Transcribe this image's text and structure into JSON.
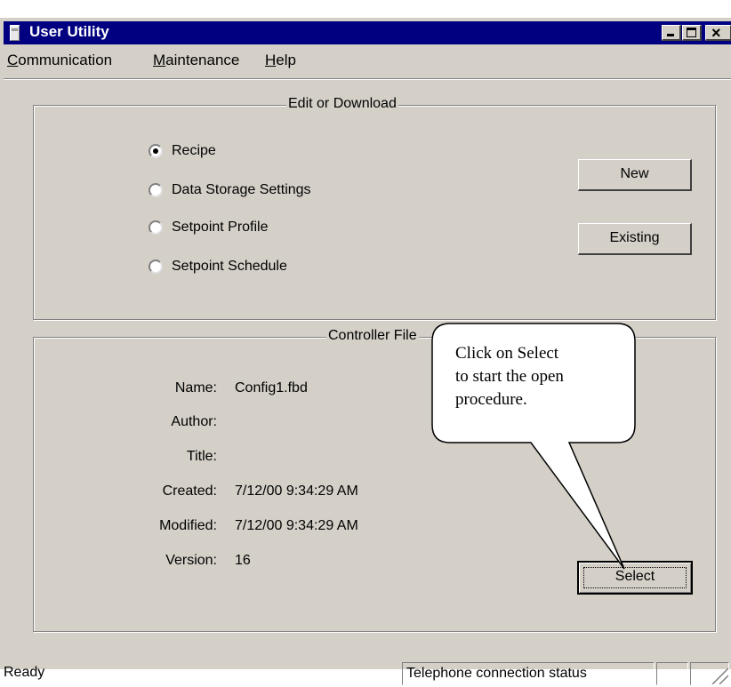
{
  "window": {
    "title": "User Utility",
    "close_glyph": "×"
  },
  "menu": [
    {
      "label": "Communication"
    },
    {
      "label": "Maintenance"
    },
    {
      "label": "Help"
    }
  ],
  "edit_group": {
    "title": "Edit or Download",
    "options": [
      {
        "label": "Recipe",
        "checked": true
      },
      {
        "label": "Data Storage Settings",
        "checked": false
      },
      {
        "label": "Setpoint Profile",
        "checked": false
      },
      {
        "label": "Setpoint Schedule",
        "checked": false
      }
    ],
    "new_label": "New",
    "existing_label": "Existing"
  },
  "controller_group": {
    "title": "Controller File",
    "fields": [
      {
        "label": "Name:",
        "value": "Config1.fbd"
      },
      {
        "label": "Author:",
        "value": ""
      },
      {
        "label": "Title:",
        "value": ""
      },
      {
        "label": "Created:",
        "value": "7/12/00 9:34:29 AM"
      },
      {
        "label": "Modified:",
        "value": "7/12/00 9:34:29 AM"
      },
      {
        "label": "Version:",
        "value": "16"
      }
    ],
    "select_label": "Select"
  },
  "callout": {
    "lines": [
      "Click on Select",
      "to start the open",
      "procedure."
    ]
  },
  "status": {
    "ready": "Ready",
    "telephone": "Telephone connection status"
  },
  "colors": {
    "titlebar": "#000080",
    "face": "#d4d0c8"
  }
}
